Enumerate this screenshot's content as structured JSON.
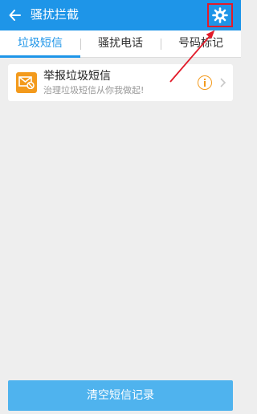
{
  "header": {
    "title": "骚扰拦截",
    "back_icon": "arrow-left-icon",
    "settings_icon": "gear-icon",
    "background": "#1e95e8"
  },
  "tabs": [
    {
      "label": "垃圾短信",
      "active": true
    },
    {
      "label": "骚扰电话",
      "active": false
    },
    {
      "label": "号码标记",
      "active": false
    }
  ],
  "report_card": {
    "title": "举报垃圾短信",
    "subtitle": "治理垃圾短信从你我做起!",
    "icon": "envelope-block-icon",
    "accent": "#f39a1c"
  },
  "footer": {
    "clear_label": "清空短信记录",
    "button_color": "#4fb3ee"
  },
  "annotation": {
    "color": "#e21b2a"
  }
}
